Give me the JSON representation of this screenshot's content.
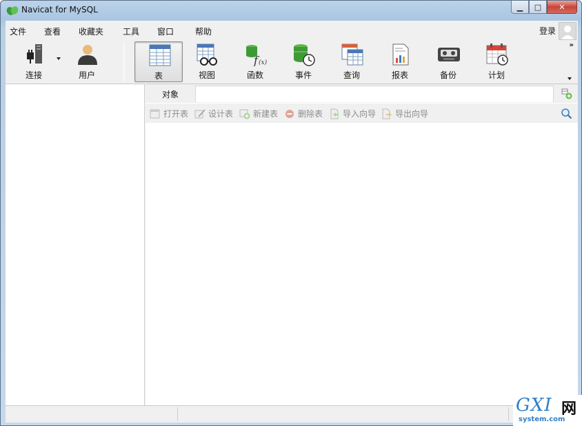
{
  "window": {
    "title": "Navicat for MySQL",
    "controls": {
      "minimize": "▁",
      "maximize": "□",
      "close": "✕"
    }
  },
  "menubar": {
    "items": [
      "文件",
      "查看",
      "收藏夹",
      "工具",
      "窗口",
      "帮助"
    ],
    "login_label": "登录"
  },
  "toolbar": {
    "buttons": [
      {
        "label": "连接",
        "icon": "connection-plug-icon"
      },
      {
        "label": "用户",
        "icon": "user-icon"
      },
      {
        "label": "表",
        "icon": "table-icon",
        "active": true
      },
      {
        "label": "视图",
        "icon": "view-icon"
      },
      {
        "label": "函数",
        "icon": "function-icon"
      },
      {
        "label": "事件",
        "icon": "event-icon"
      },
      {
        "label": "查询",
        "icon": "query-icon"
      },
      {
        "label": "报表",
        "icon": "report-icon"
      },
      {
        "label": "备份",
        "icon": "backup-icon"
      },
      {
        "label": "计划",
        "icon": "schedule-icon"
      }
    ],
    "more_chevron": "»"
  },
  "object_bar": {
    "label": "对象",
    "search_value": ""
  },
  "actions": {
    "items": [
      {
        "label": "打开表",
        "icon": "open-table-icon"
      },
      {
        "label": "设计表",
        "icon": "design-table-icon"
      },
      {
        "label": "新建表",
        "icon": "new-table-icon"
      },
      {
        "label": "删除表",
        "icon": "delete-table-icon"
      },
      {
        "label": "导入向导",
        "icon": "import-wizard-icon"
      },
      {
        "label": "导出向导",
        "icon": "export-wizard-icon"
      }
    ]
  },
  "watermark": {
    "main": "GXI",
    "net": "网",
    "sub": "system.com"
  },
  "colors": {
    "accent_blue": "#2f7fc7",
    "disabled_text": "#8c8c8c",
    "titlebar": "#b8cfe6"
  }
}
